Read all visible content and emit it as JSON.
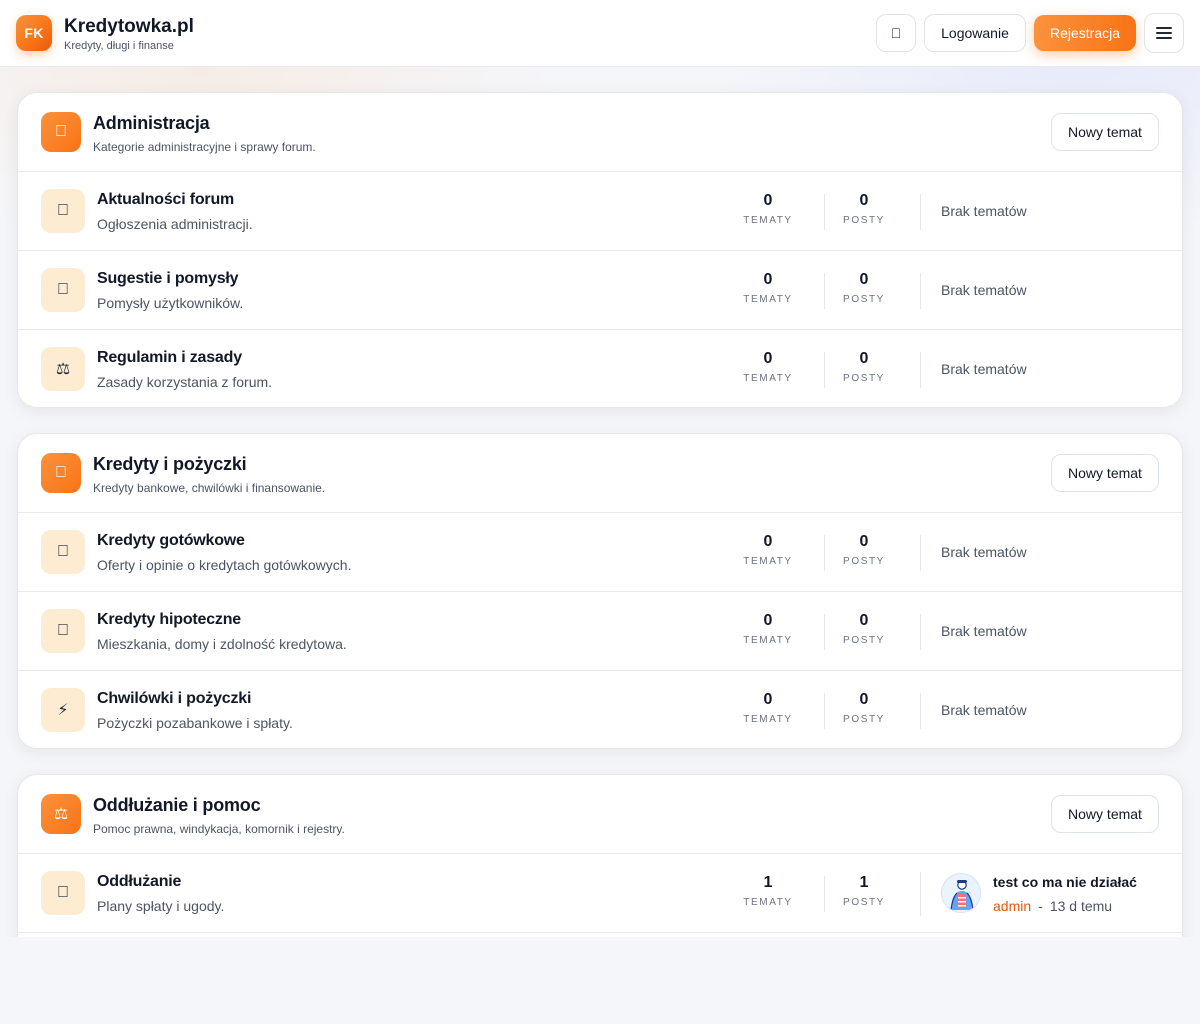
{
  "header": {
    "logo_text": "FK",
    "site_title": "Kredytowka.pl",
    "tagline": "Kredyty, długi i finanse",
    "theme_icon": "",
    "login_label": "Logowanie",
    "register_label": "Rejestracja"
  },
  "labels": {
    "topics": "TEMATY",
    "posts": "POSTY",
    "new_topic": "Nowy temat",
    "no_topics": "Brak tematów"
  },
  "categories": [
    {
      "icon": "",
      "title": "Administracja",
      "description": "Kategorie administracyjne i sprawy forum.",
      "forums": [
        {
          "icon": "",
          "title": "Aktualności forum",
          "description": "Ogłoszenia administracji.",
          "topics": "0",
          "posts": "0"
        },
        {
          "icon": "",
          "title": "Sugestie i pomysły",
          "description": "Pomysły użytkowników.",
          "topics": "0",
          "posts": "0"
        },
        {
          "icon": "⚖",
          "title": "Regulamin i zasady",
          "description": "Zasady korzystania z forum.",
          "topics": "0",
          "posts": "0"
        }
      ]
    },
    {
      "icon": "",
      "title": "Kredyty i pożyczki",
      "description": "Kredyty bankowe, chwilówki i finansowanie.",
      "forums": [
        {
          "icon": "",
          "title": "Kredyty gotówkowe",
          "description": "Oferty i opinie o kredytach gotówkowych.",
          "topics": "0",
          "posts": "0"
        },
        {
          "icon": "",
          "title": "Kredyty hipoteczne",
          "description": "Mieszkania, domy i zdolność kredytowa.",
          "topics": "0",
          "posts": "0"
        },
        {
          "icon": "⚡",
          "title": "Chwilówki i pożyczki",
          "description": "Pożyczki pozabankowe i spłaty.",
          "topics": "0",
          "posts": "0"
        }
      ]
    },
    {
      "icon": "⚖",
      "title": "Oddłużanie i pomoc",
      "description": "Pomoc prawna, windykacja, komornik i rejestry.",
      "forums": [
        {
          "icon": "",
          "title": "Oddłużanie",
          "description": "Plany spłaty i ugody.",
          "topics": "1",
          "posts": "1",
          "last_post": {
            "title": "test co ma nie działać",
            "author": "admin",
            "separator": "-",
            "time": "13 d temu"
          }
        }
      ]
    }
  ],
  "colors": {
    "accent": "#f97316",
    "accent_light": "#fb923c",
    "forum_icon_bg": "#fdecd2",
    "author": "#ea580c"
  },
  "icons": {
    "theme_toggle": "moon-icon",
    "menu": "hamburger-menu-icon",
    "category_1": "shield-icon",
    "category_2": "wallet-icon",
    "category_3": "scales-icon"
  }
}
